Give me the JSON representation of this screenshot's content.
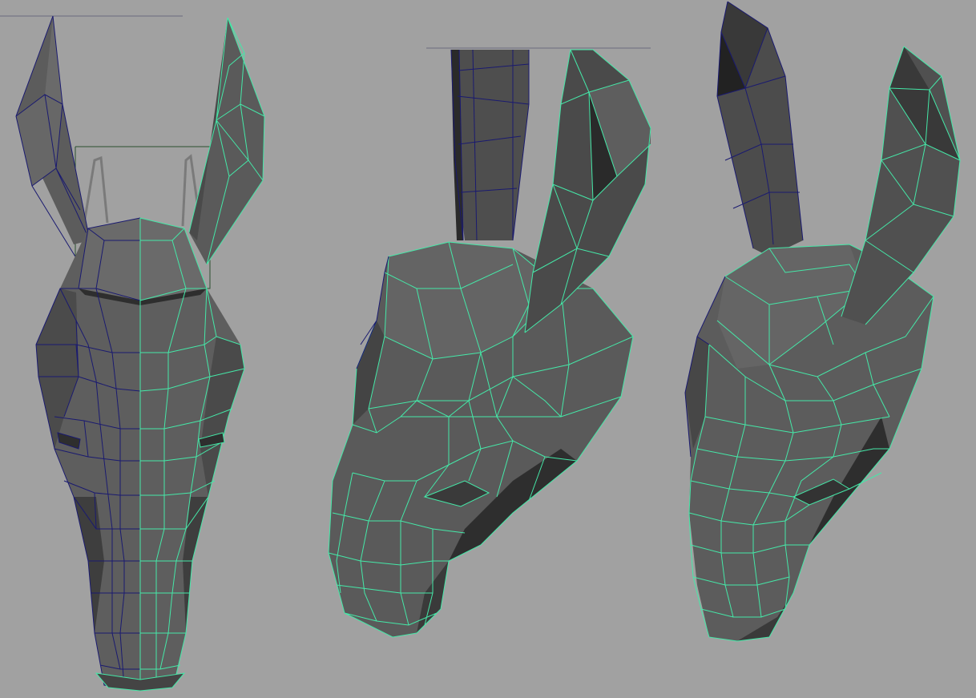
{
  "viewport": {
    "background": "#a1a1a1",
    "shade_dark": "#3b3b3b",
    "shade_mid": "#555555",
    "shade_light": "#666666",
    "wire_selected": "#45e8a8",
    "wire_unselected": "#1a1a70",
    "view_count": 3
  }
}
